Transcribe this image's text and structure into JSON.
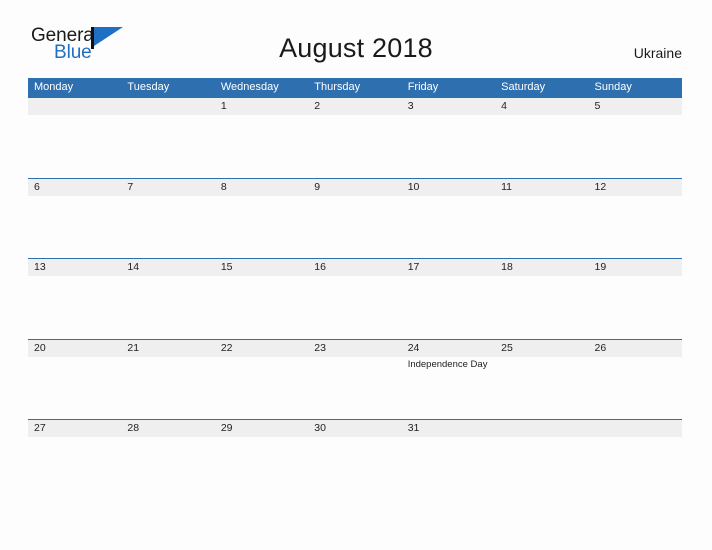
{
  "brand": {
    "word_one": "General",
    "word_two": "Blue",
    "flag_icon": "flag-icon",
    "accent_color": "#1f6fc4"
  },
  "header": {
    "title": "August 2018",
    "region": "Ukraine"
  },
  "theme": {
    "header_blue": "#2e6fb0",
    "band_gray": "#efefef",
    "page_background": "#fdfdfd",
    "text_color": "#222222"
  },
  "calendar": {
    "weekday_headers": [
      "Monday",
      "Tuesday",
      "Wednesday",
      "Thursday",
      "Friday",
      "Saturday",
      "Sunday"
    ],
    "weeks": [
      [
        {
          "day": "",
          "event": ""
        },
        {
          "day": "",
          "event": ""
        },
        {
          "day": "1",
          "event": ""
        },
        {
          "day": "2",
          "event": ""
        },
        {
          "day": "3",
          "event": ""
        },
        {
          "day": "4",
          "event": ""
        },
        {
          "day": "5",
          "event": ""
        }
      ],
      [
        {
          "day": "6",
          "event": ""
        },
        {
          "day": "7",
          "event": ""
        },
        {
          "day": "8",
          "event": ""
        },
        {
          "day": "9",
          "event": ""
        },
        {
          "day": "10",
          "event": ""
        },
        {
          "day": "11",
          "event": ""
        },
        {
          "day": "12",
          "event": ""
        }
      ],
      [
        {
          "day": "13",
          "event": ""
        },
        {
          "day": "14",
          "event": ""
        },
        {
          "day": "15",
          "event": ""
        },
        {
          "day": "16",
          "event": ""
        },
        {
          "day": "17",
          "event": ""
        },
        {
          "day": "18",
          "event": ""
        },
        {
          "day": "19",
          "event": ""
        }
      ],
      [
        {
          "day": "20",
          "event": ""
        },
        {
          "day": "21",
          "event": ""
        },
        {
          "day": "22",
          "event": ""
        },
        {
          "day": "23",
          "event": ""
        },
        {
          "day": "24",
          "event": "Independence Day"
        },
        {
          "day": "25",
          "event": ""
        },
        {
          "day": "26",
          "event": ""
        }
      ],
      [
        {
          "day": "27",
          "event": ""
        },
        {
          "day": "28",
          "event": ""
        },
        {
          "day": "29",
          "event": ""
        },
        {
          "day": "30",
          "event": ""
        },
        {
          "day": "31",
          "event": ""
        },
        {
          "day": "",
          "event": ""
        },
        {
          "day": "",
          "event": ""
        }
      ]
    ]
  }
}
